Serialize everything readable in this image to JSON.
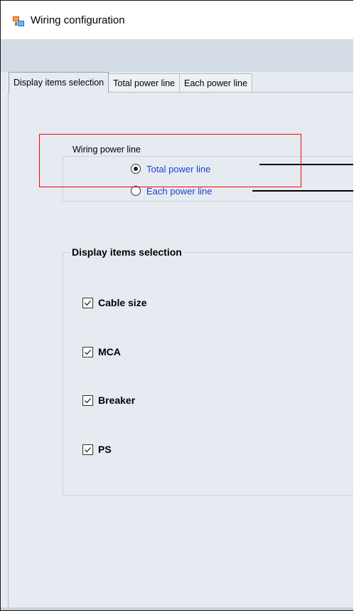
{
  "window": {
    "title": "Wiring configuration",
    "app_icon": "wiring-app-icon"
  },
  "tabs": [
    {
      "label": "Display items selection",
      "active": true
    },
    {
      "label": "Total power line",
      "active": false
    },
    {
      "label": "Each power line",
      "active": false
    }
  ],
  "wiring_group": {
    "label": "Wiring power line",
    "options": [
      {
        "label": "Total power line",
        "selected": true
      },
      {
        "label": "Each power line",
        "selected": false
      }
    ]
  },
  "display_group": {
    "label": "Display items selection",
    "items": [
      {
        "label": "Cable size",
        "checked": true
      },
      {
        "label": "MCA",
        "checked": true
      },
      {
        "label": "Breaker",
        "checked": true
      },
      {
        "label": "PS",
        "checked": true
      }
    ]
  },
  "colors": {
    "highlight": "#ff0000",
    "radio_label": "#1f3fcf",
    "background": "#e6ebf1"
  }
}
